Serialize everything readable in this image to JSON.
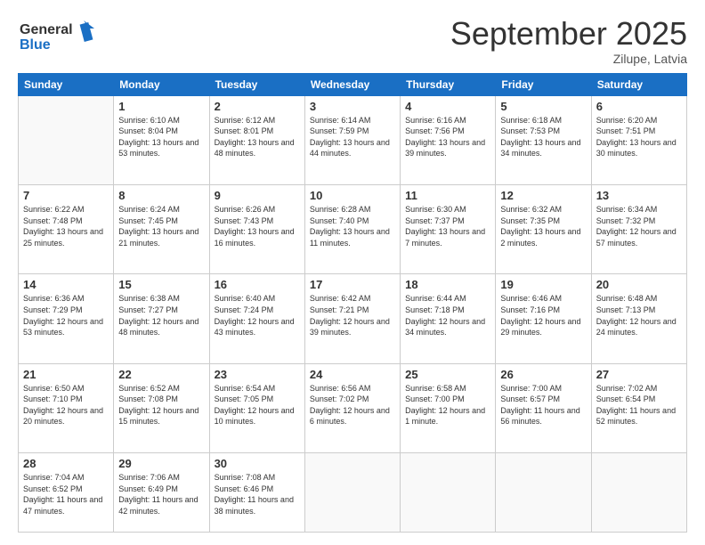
{
  "logo": {
    "line1": "General",
    "line2": "Blue"
  },
  "title": "September 2025",
  "location": "Zilupe, Latvia",
  "weekdays": [
    "Sunday",
    "Monday",
    "Tuesday",
    "Wednesday",
    "Thursday",
    "Friday",
    "Saturday"
  ],
  "weeks": [
    [
      {
        "day": "",
        "sunrise": "",
        "sunset": "",
        "daylight": ""
      },
      {
        "day": "1",
        "sunrise": "Sunrise: 6:10 AM",
        "sunset": "Sunset: 8:04 PM",
        "daylight": "Daylight: 13 hours and 53 minutes."
      },
      {
        "day": "2",
        "sunrise": "Sunrise: 6:12 AM",
        "sunset": "Sunset: 8:01 PM",
        "daylight": "Daylight: 13 hours and 48 minutes."
      },
      {
        "day": "3",
        "sunrise": "Sunrise: 6:14 AM",
        "sunset": "Sunset: 7:59 PM",
        "daylight": "Daylight: 13 hours and 44 minutes."
      },
      {
        "day": "4",
        "sunrise": "Sunrise: 6:16 AM",
        "sunset": "Sunset: 7:56 PM",
        "daylight": "Daylight: 13 hours and 39 minutes."
      },
      {
        "day": "5",
        "sunrise": "Sunrise: 6:18 AM",
        "sunset": "Sunset: 7:53 PM",
        "daylight": "Daylight: 13 hours and 34 minutes."
      },
      {
        "day": "6",
        "sunrise": "Sunrise: 6:20 AM",
        "sunset": "Sunset: 7:51 PM",
        "daylight": "Daylight: 13 hours and 30 minutes."
      }
    ],
    [
      {
        "day": "7",
        "sunrise": "Sunrise: 6:22 AM",
        "sunset": "Sunset: 7:48 PM",
        "daylight": "Daylight: 13 hours and 25 minutes."
      },
      {
        "day": "8",
        "sunrise": "Sunrise: 6:24 AM",
        "sunset": "Sunset: 7:45 PM",
        "daylight": "Daylight: 13 hours and 21 minutes."
      },
      {
        "day": "9",
        "sunrise": "Sunrise: 6:26 AM",
        "sunset": "Sunset: 7:43 PM",
        "daylight": "Daylight: 13 hours and 16 minutes."
      },
      {
        "day": "10",
        "sunrise": "Sunrise: 6:28 AM",
        "sunset": "Sunset: 7:40 PM",
        "daylight": "Daylight: 13 hours and 11 minutes."
      },
      {
        "day": "11",
        "sunrise": "Sunrise: 6:30 AM",
        "sunset": "Sunset: 7:37 PM",
        "daylight": "Daylight: 13 hours and 7 minutes."
      },
      {
        "day": "12",
        "sunrise": "Sunrise: 6:32 AM",
        "sunset": "Sunset: 7:35 PM",
        "daylight": "Daylight: 13 hours and 2 minutes."
      },
      {
        "day": "13",
        "sunrise": "Sunrise: 6:34 AM",
        "sunset": "Sunset: 7:32 PM",
        "daylight": "Daylight: 12 hours and 57 minutes."
      }
    ],
    [
      {
        "day": "14",
        "sunrise": "Sunrise: 6:36 AM",
        "sunset": "Sunset: 7:29 PM",
        "daylight": "Daylight: 12 hours and 53 minutes."
      },
      {
        "day": "15",
        "sunrise": "Sunrise: 6:38 AM",
        "sunset": "Sunset: 7:27 PM",
        "daylight": "Daylight: 12 hours and 48 minutes."
      },
      {
        "day": "16",
        "sunrise": "Sunrise: 6:40 AM",
        "sunset": "Sunset: 7:24 PM",
        "daylight": "Daylight: 12 hours and 43 minutes."
      },
      {
        "day": "17",
        "sunrise": "Sunrise: 6:42 AM",
        "sunset": "Sunset: 7:21 PM",
        "daylight": "Daylight: 12 hours and 39 minutes."
      },
      {
        "day": "18",
        "sunrise": "Sunrise: 6:44 AM",
        "sunset": "Sunset: 7:18 PM",
        "daylight": "Daylight: 12 hours and 34 minutes."
      },
      {
        "day": "19",
        "sunrise": "Sunrise: 6:46 AM",
        "sunset": "Sunset: 7:16 PM",
        "daylight": "Daylight: 12 hours and 29 minutes."
      },
      {
        "day": "20",
        "sunrise": "Sunrise: 6:48 AM",
        "sunset": "Sunset: 7:13 PM",
        "daylight": "Daylight: 12 hours and 24 minutes."
      }
    ],
    [
      {
        "day": "21",
        "sunrise": "Sunrise: 6:50 AM",
        "sunset": "Sunset: 7:10 PM",
        "daylight": "Daylight: 12 hours and 20 minutes."
      },
      {
        "day": "22",
        "sunrise": "Sunrise: 6:52 AM",
        "sunset": "Sunset: 7:08 PM",
        "daylight": "Daylight: 12 hours and 15 minutes."
      },
      {
        "day": "23",
        "sunrise": "Sunrise: 6:54 AM",
        "sunset": "Sunset: 7:05 PM",
        "daylight": "Daylight: 12 hours and 10 minutes."
      },
      {
        "day": "24",
        "sunrise": "Sunrise: 6:56 AM",
        "sunset": "Sunset: 7:02 PM",
        "daylight": "Daylight: 12 hours and 6 minutes."
      },
      {
        "day": "25",
        "sunrise": "Sunrise: 6:58 AM",
        "sunset": "Sunset: 7:00 PM",
        "daylight": "Daylight: 12 hours and 1 minute."
      },
      {
        "day": "26",
        "sunrise": "Sunrise: 7:00 AM",
        "sunset": "Sunset: 6:57 PM",
        "daylight": "Daylight: 11 hours and 56 minutes."
      },
      {
        "day": "27",
        "sunrise": "Sunrise: 7:02 AM",
        "sunset": "Sunset: 6:54 PM",
        "daylight": "Daylight: 11 hours and 52 minutes."
      }
    ],
    [
      {
        "day": "28",
        "sunrise": "Sunrise: 7:04 AM",
        "sunset": "Sunset: 6:52 PM",
        "daylight": "Daylight: 11 hours and 47 minutes."
      },
      {
        "day": "29",
        "sunrise": "Sunrise: 7:06 AM",
        "sunset": "Sunset: 6:49 PM",
        "daylight": "Daylight: 11 hours and 42 minutes."
      },
      {
        "day": "30",
        "sunrise": "Sunrise: 7:08 AM",
        "sunset": "Sunset: 6:46 PM",
        "daylight": "Daylight: 11 hours and 38 minutes."
      },
      {
        "day": "",
        "sunrise": "",
        "sunset": "",
        "daylight": ""
      },
      {
        "day": "",
        "sunrise": "",
        "sunset": "",
        "daylight": ""
      },
      {
        "day": "",
        "sunrise": "",
        "sunset": "",
        "daylight": ""
      },
      {
        "day": "",
        "sunrise": "",
        "sunset": "",
        "daylight": ""
      }
    ]
  ]
}
